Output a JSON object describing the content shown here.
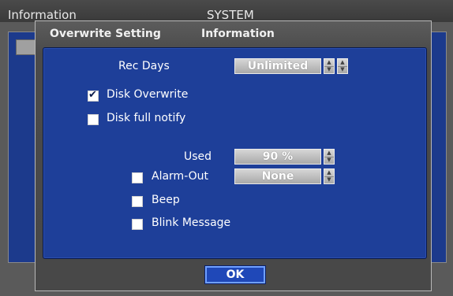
{
  "background": {
    "title_left": "Information",
    "title_center": "SYSTEM"
  },
  "dialog": {
    "tabs": [
      "Overwrite Setting",
      "Information"
    ],
    "rec_days": {
      "label": "Rec Days",
      "value": "Unlimited"
    },
    "disk_overwrite": {
      "label": "Disk Overwrite",
      "checked": true
    },
    "disk_full_notify": {
      "label": "Disk full notify",
      "checked": false
    },
    "used": {
      "label": "Used",
      "value": "90 %"
    },
    "alarm_out": {
      "label": "Alarm-Out",
      "value": "None",
      "checked": false
    },
    "beep": {
      "label": "Beep",
      "checked": false
    },
    "blink_message": {
      "label": "Blink Message",
      "checked": false
    },
    "ok_label": "OK"
  },
  "colors": {
    "panel": "#1e3f99",
    "dialog": "#4a4a4a",
    "button_border": "#6fa0ff"
  },
  "icons": {
    "spin": "up-down-arrows-icon",
    "check": "checkmark-icon"
  }
}
